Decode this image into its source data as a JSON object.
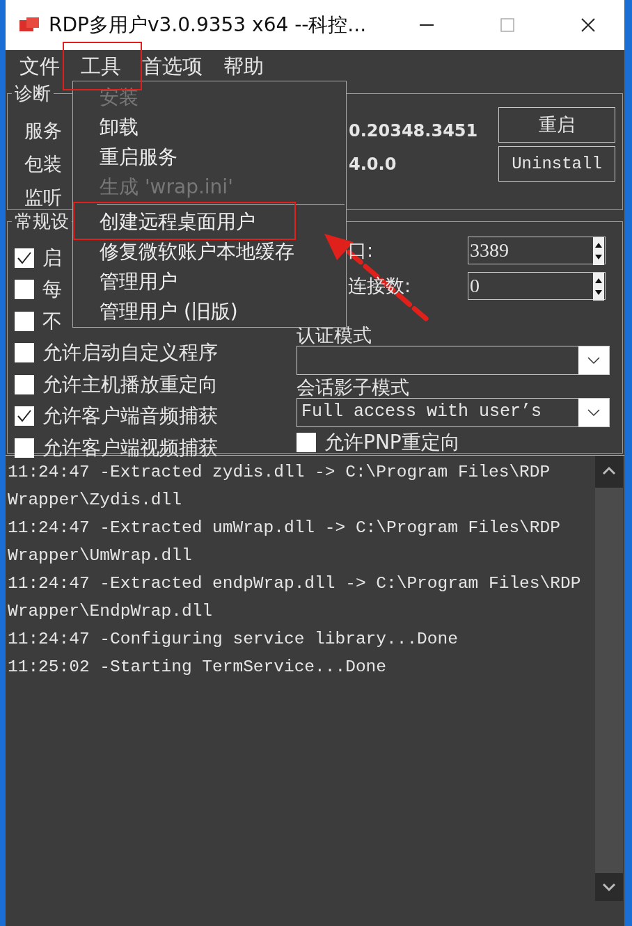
{
  "window": {
    "title": "RDP多用户v3.0.9353 x64 --科控..."
  },
  "menubar": [
    {
      "label": "文件"
    },
    {
      "label": "工具"
    },
    {
      "label": "首选项"
    },
    {
      "label": "帮助"
    }
  ],
  "dropdown": [
    {
      "kind": "item",
      "label": "安装",
      "disabled": true
    },
    {
      "kind": "item",
      "label": "卸载",
      "disabled": false
    },
    {
      "kind": "item",
      "label": "重启服务",
      "disabled": false
    },
    {
      "kind": "item",
      "label": "生成 'wrap.ini'",
      "disabled": true
    },
    {
      "kind": "separator"
    },
    {
      "kind": "item",
      "label": "创建远程桌面用户",
      "disabled": false
    },
    {
      "kind": "item",
      "label": "修复微软账户本地缓存",
      "disabled": false
    },
    {
      "kind": "item",
      "label": "管理用户",
      "disabled": false
    },
    {
      "kind": "item",
      "label": "管理用户 (旧版)",
      "disabled": false
    }
  ],
  "diagnostics": {
    "title": "诊断",
    "rows": [
      {
        "label": "服务",
        "value": "0.20348.3451"
      },
      {
        "label": "包装",
        "value": "4.0.0"
      },
      {
        "label": "监听"
      }
    ],
    "buttons": [
      "重启",
      "Uninstall"
    ]
  },
  "general": {
    "title": "常规设",
    "checkboxes": [
      {
        "label": "启",
        "checked": true
      },
      {
        "label": "每",
        "checked": false
      },
      {
        "label": "不",
        "checked": false
      },
      {
        "label": "允许启动自定义程序",
        "checked": false
      },
      {
        "label": "允许主机播放重定向",
        "checked": false
      },
      {
        "label": "允许客户端音频捕获",
        "checked": true
      },
      {
        "label": "允许客户端视频捕获",
        "checked": false
      }
    ],
    "port": {
      "label": "口:",
      "value": "3389"
    },
    "connections": {
      "label": "连接数:",
      "value": "0"
    },
    "auth_mode": {
      "label": "认证模式"
    },
    "shadow_mode": {
      "label": "会话影子模式",
      "value": "Full access with user’s"
    },
    "pnp": {
      "label": "允许PNP重定向",
      "checked": false
    }
  },
  "log": [
    "11:24:47 -Extracted zydis.dll -> C:\\Program Files\\RDP Wrapper\\Zydis.dll",
    "11:24:47 -Extracted umWrap.dll -> C:\\Program Files\\RDP Wrapper\\UmWrap.dll",
    "11:24:47 -Extracted endpWrap.dll -> C:\\Program Files\\RDP Wrapper\\EndpWrap.dll",
    "11:24:47 -Configuring service library...Done",
    "11:25:02 -Starting TermService...Done"
  ]
}
